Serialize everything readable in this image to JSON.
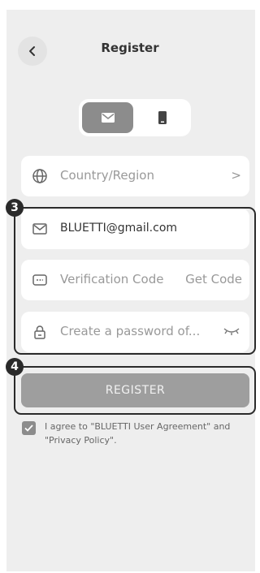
{
  "header": {
    "title": "Register"
  },
  "icons": {
    "back": "chevron-left-icon",
    "email_tab": "envelope-icon",
    "phone_tab": "phone-icon",
    "country": "globe-icon",
    "email": "envelope-icon",
    "code": "message-icon",
    "password": "lock-icon",
    "visibility": "eye-closed-icon"
  },
  "form": {
    "country": {
      "placeholder": "Country/Region",
      "chevron": ">"
    },
    "email": {
      "value": "BLUETTI@gmail.com"
    },
    "code": {
      "placeholder": "Verification Code",
      "action": "Get Code"
    },
    "password": {
      "placeholder": "Create a password of..."
    }
  },
  "annotations": {
    "fields_badge": "3",
    "button_badge": "4"
  },
  "register_button": {
    "label": "REGISTER"
  },
  "agreement": {
    "checked": true,
    "text": "I agree to \"BLUETTI User Agreement\" and \"Privacy Policy\"."
  },
  "colors": {
    "background": "#eeeeee",
    "field": "#ffffff",
    "button": "#9e9e9e",
    "annotation": "#2a2a2a"
  }
}
